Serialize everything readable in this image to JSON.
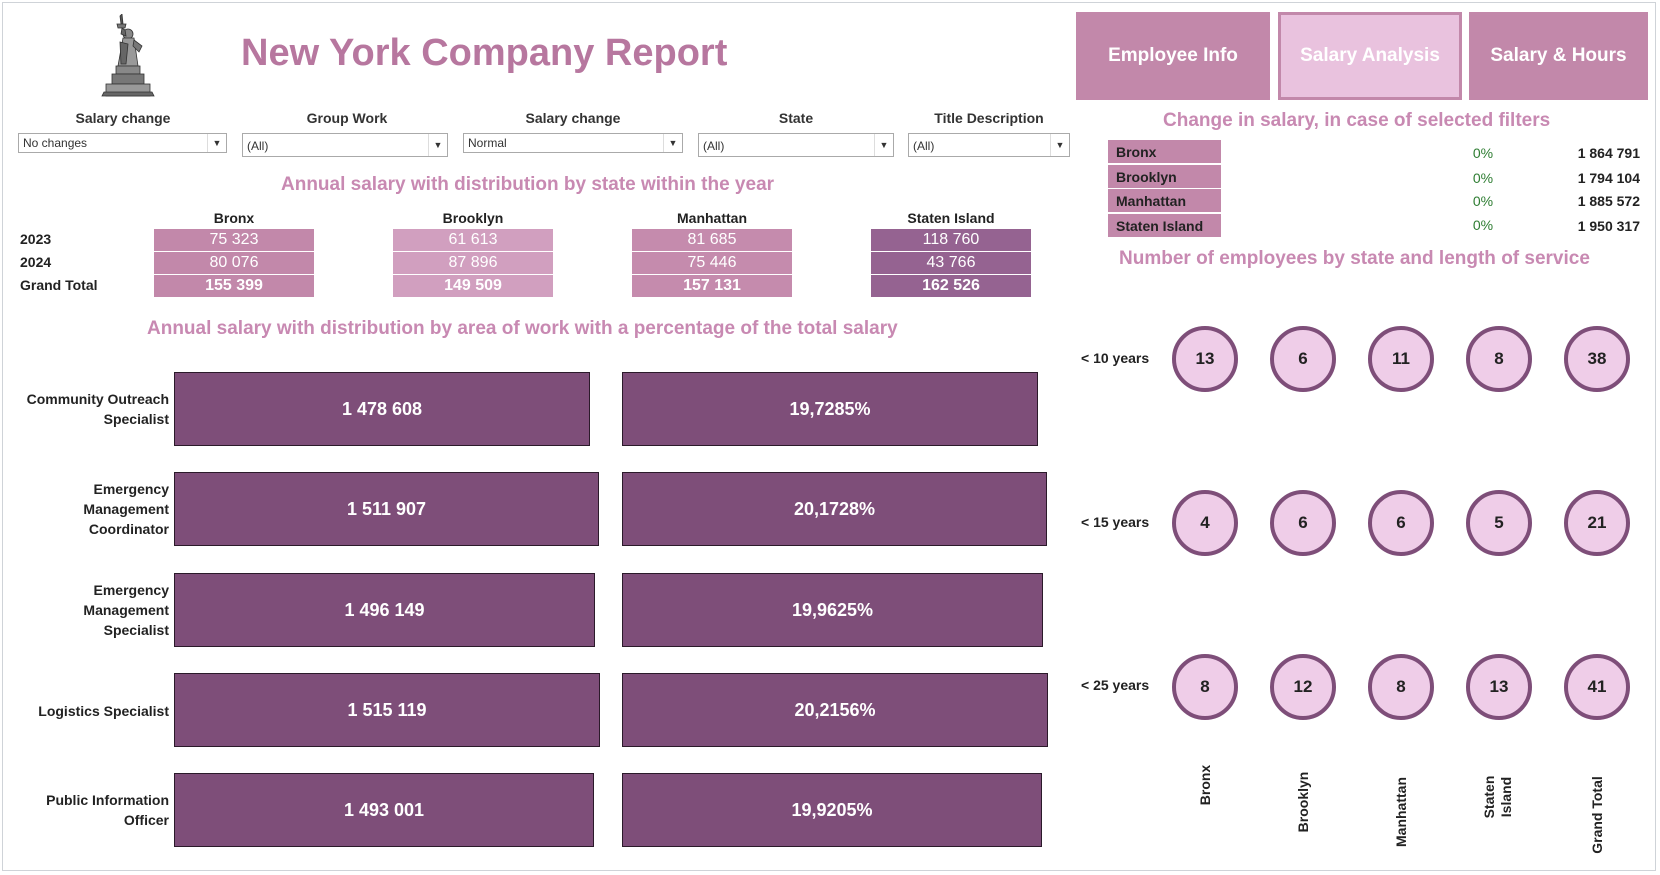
{
  "header": {
    "title": "New York Company Report",
    "logo": "statue-of-liberty"
  },
  "nav": {
    "employee_info": "Employee Info",
    "salary_analysis": "Salary Analysis",
    "salary_hours": "Salary & Hours"
  },
  "filters": [
    {
      "label": "Salary change",
      "value": "No changes"
    },
    {
      "label": "Group Work",
      "value": "(All)"
    },
    {
      "label": "Salary change",
      "value": "Normal"
    },
    {
      "label": "State",
      "value": "(All)"
    },
    {
      "label": "Title Description",
      "value": "(All)"
    }
  ],
  "state_section": {
    "title": "Annual salary with distribution by state within the year",
    "row_labels": [
      "2023",
      "2024",
      "Grand Total"
    ],
    "states": [
      {
        "name": "Bronx",
        "y2023": "75 323",
        "y2024": "80 076",
        "total": "155 399",
        "color": "#c288aa"
      },
      {
        "name": "Brooklyn",
        "y2023": "61 613",
        "y2024": "87 896",
        "total": "149 509",
        "color": "#d19fbf"
      },
      {
        "name": "Manhattan",
        "y2023": "81 685",
        "y2024": "75 446",
        "total": "157 131",
        "color": "#c58bad"
      },
      {
        "name": "Staten Island",
        "y2023": "118 760",
        "y2024": "43 766",
        "total": "162 526",
        "color": "#956391"
      }
    ]
  },
  "area_section": {
    "title": "Annual salary with distribution by area of work with a percentage of the total salary",
    "rows": [
      {
        "label": "Community Outreach Specialist",
        "salary": "1 478 608",
        "salary_value": 1478608,
        "pct": "19,7285%",
        "pct_value": 19.7285
      },
      {
        "label": "Emergency Management Coordinator",
        "salary": "1 511 907",
        "salary_value": 1511907,
        "pct": "20,1728%",
        "pct_value": 20.1728
      },
      {
        "label": "Emergency Management Specialist",
        "salary": "1 496 149",
        "salary_value": 1496149,
        "pct": "19,9625%",
        "pct_value": 19.9625
      },
      {
        "label": "Logistics Specialist",
        "salary": "1 515 119",
        "salary_value": 1515119,
        "pct": "20,2156%",
        "pct_value": 20.2156
      },
      {
        "label": "Public Information Officer",
        "salary": "1 493 001",
        "salary_value": 1493001,
        "pct": "19,9205%",
        "pct_value": 19.9205
      }
    ]
  },
  "change_section": {
    "title": "Change in salary, in case of selected filters",
    "rows": [
      {
        "state": "Bronx",
        "pct": "0%",
        "value": "1 864 791"
      },
      {
        "state": "Brooklyn",
        "pct": "0%",
        "value": "1 794 104"
      },
      {
        "state": "Manhattan",
        "pct": "0%",
        "value": "1 885 572"
      },
      {
        "state": "Staten Island",
        "pct": "0%",
        "value": "1 950 317"
      }
    ]
  },
  "employees_section": {
    "title": "Number of employees by state and length of service",
    "columns": [
      "Bronx",
      "Brooklyn",
      "Manhattan",
      "Staten Island",
      "Grand Total"
    ],
    "rows": [
      {
        "label": "< 10 years",
        "values": [
          "13",
          "6",
          "11",
          "8",
          "38"
        ]
      },
      {
        "label": "< 15 years",
        "values": [
          "4",
          "6",
          "6",
          "5",
          "21"
        ]
      },
      {
        "label": "< 25 years",
        "values": [
          "8",
          "12",
          "8",
          "13",
          "41"
        ]
      }
    ]
  }
}
